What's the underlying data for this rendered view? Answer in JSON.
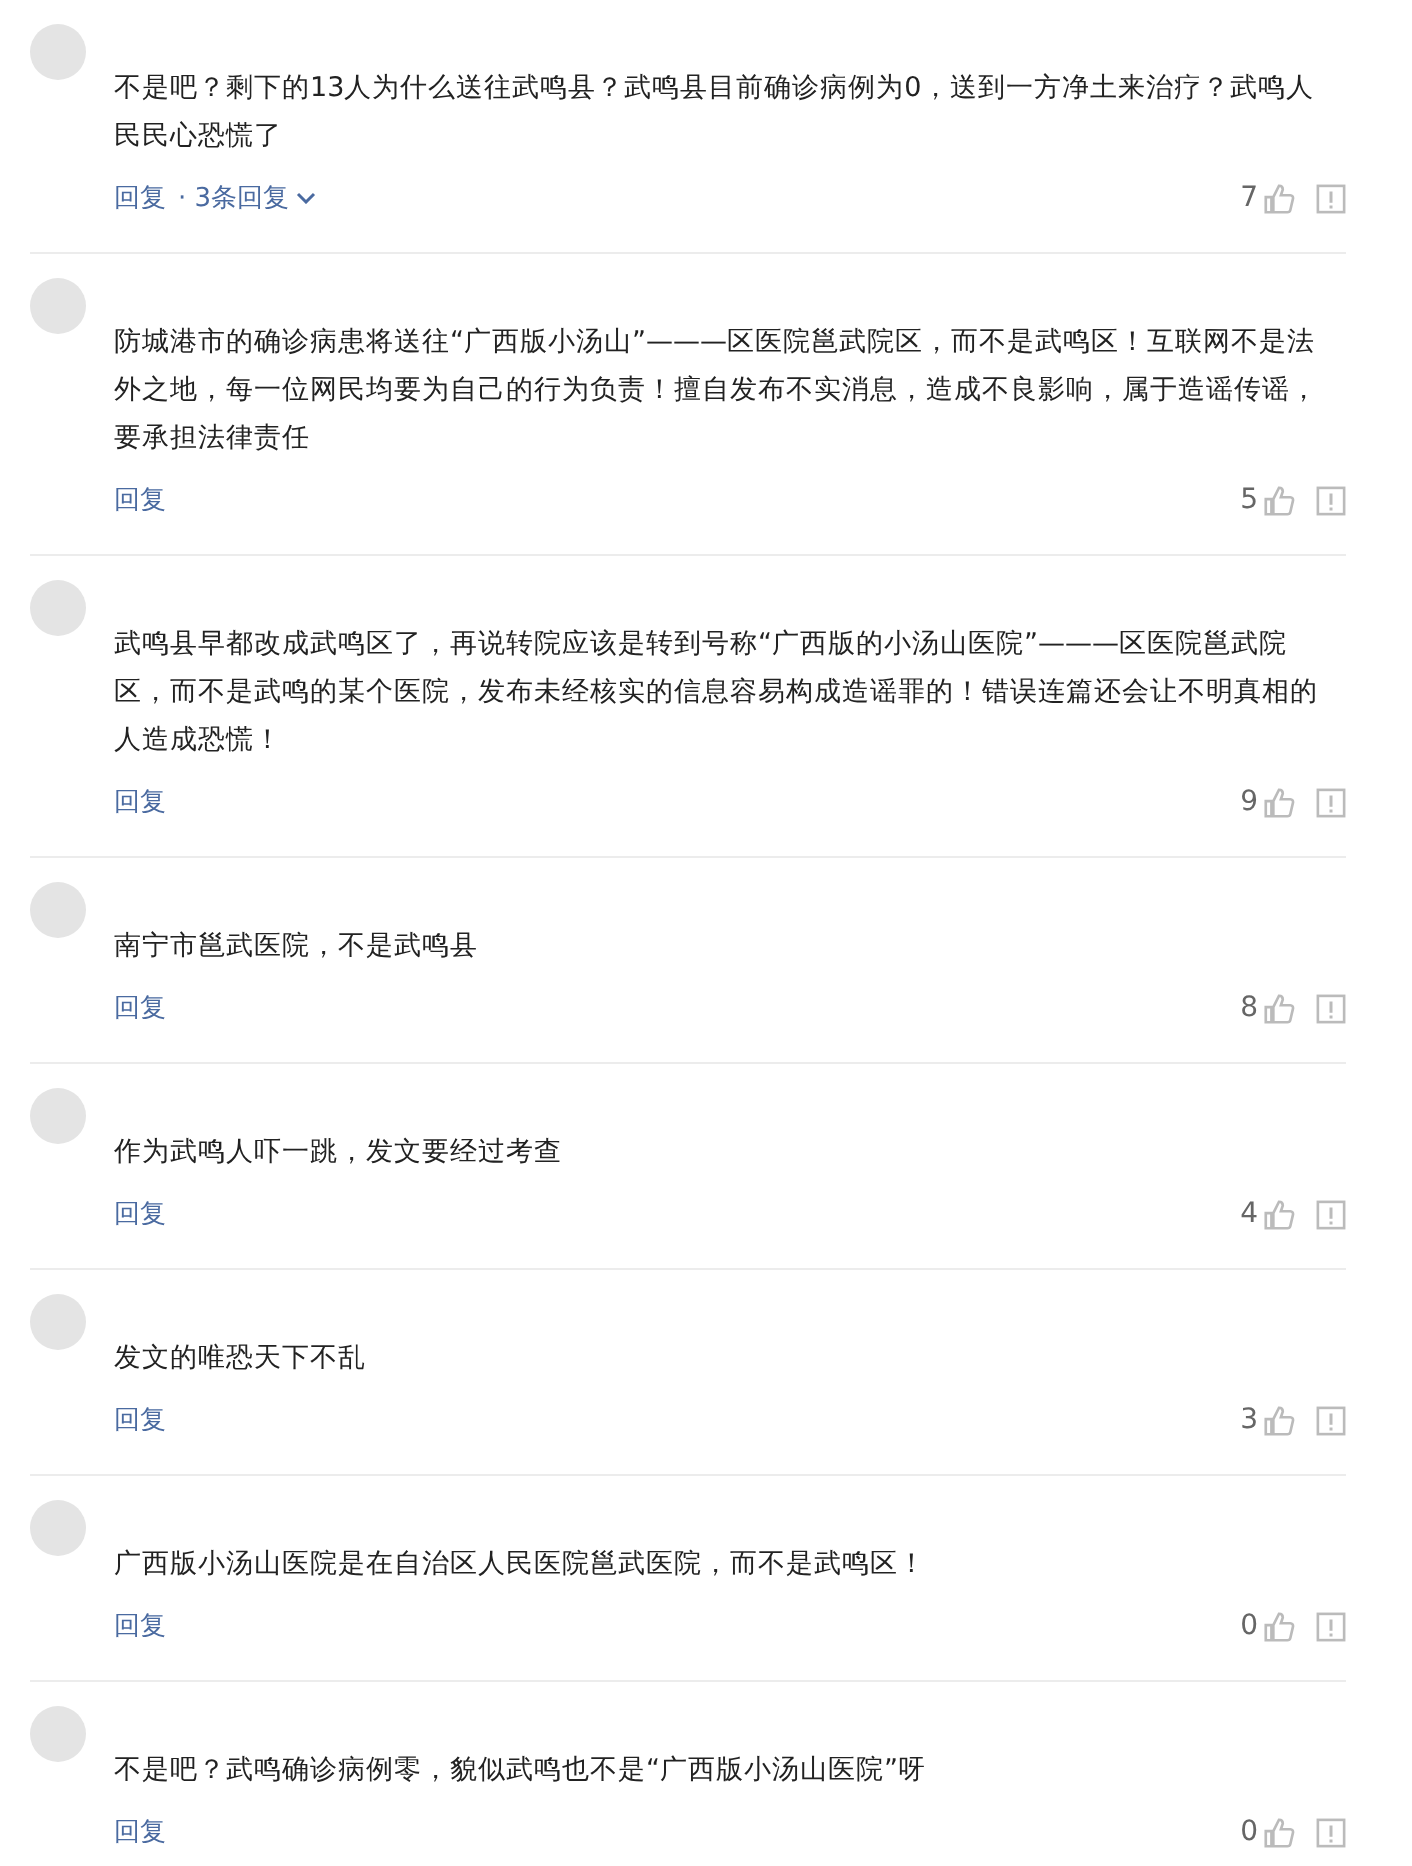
{
  "comments": [
    {
      "text": "不是吧？剩下的13人为什么送往武鸣县？武鸣县目前确诊病例为0，送到一方净土来治疗？武鸣人民民心恐慌了",
      "reply": "回复",
      "replies": "· 3条回复",
      "likes": "7"
    },
    {
      "text": "防城港市的确诊病患将送往“广西版小汤山”———区医院邕武院区，而不是武鸣区！互联网不是法外之地，每一位网民均要为自己的行为负责！擅自发布不实消息，造成不良影响，属于造谣传谣，要承担法律责任",
      "reply": "回复",
      "likes": "5"
    },
    {
      "text": "武鸣县早都改成武鸣区了，再说转院应该是转到号称“广西版的小汤山医院”———区医院邕武院区，而不是武鸣的某个医院，发布未经核实的信息容易构成造谣罪的！错误连篇还会让不明真相的人造成恐慌！",
      "reply": "回复",
      "likes": "9"
    },
    {
      "text": "南宁市邕武医院，不是武鸣县",
      "reply": "回复",
      "likes": "8"
    },
    {
      "text": "作为武鸣人吓一跳，发文要经过考查",
      "reply": "回复",
      "likes": "4"
    },
    {
      "text": "发文的唯恐天下不乱",
      "reply": "回复",
      "likes": "3"
    },
    {
      "text": "广西版小汤山医院是在自治区人民医院邕武医院，而不是武鸣区！",
      "reply": "回复",
      "likes": "0"
    },
    {
      "text": "不是吧？武鸣确诊病例零，貌似武鸣也不是“广西版小汤山医院”呀",
      "reply": "回复",
      "likes": "0"
    }
  ]
}
